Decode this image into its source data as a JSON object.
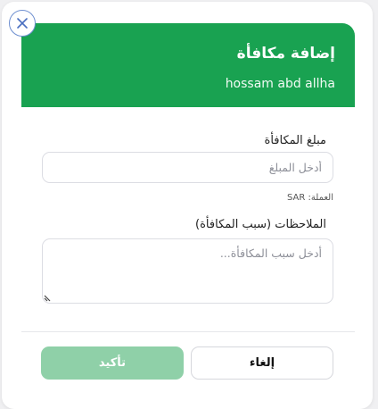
{
  "dialog": {
    "title": "إضافة مكافأة",
    "employee_name": "hossam abd allha"
  },
  "amount_field": {
    "label": "مبلغ المكافأة",
    "placeholder": "أدخل المبلغ",
    "value": "",
    "currency_note": "العملة: SAR"
  },
  "notes_field": {
    "label": "الملاحظات (سبب المكافأة)",
    "placeholder": "أدخل سبب المكافأة...",
    "value": ""
  },
  "actions": {
    "confirm_label": "تأكيد",
    "cancel_label": "إلغاء"
  },
  "colors": {
    "header_bg": "#19a251",
    "confirm_disabled_bg": "#8fd0a8",
    "close_border": "#6e8fd0"
  },
  "icons": {
    "close": "close-icon",
    "resize": "resize-handle-icon"
  }
}
